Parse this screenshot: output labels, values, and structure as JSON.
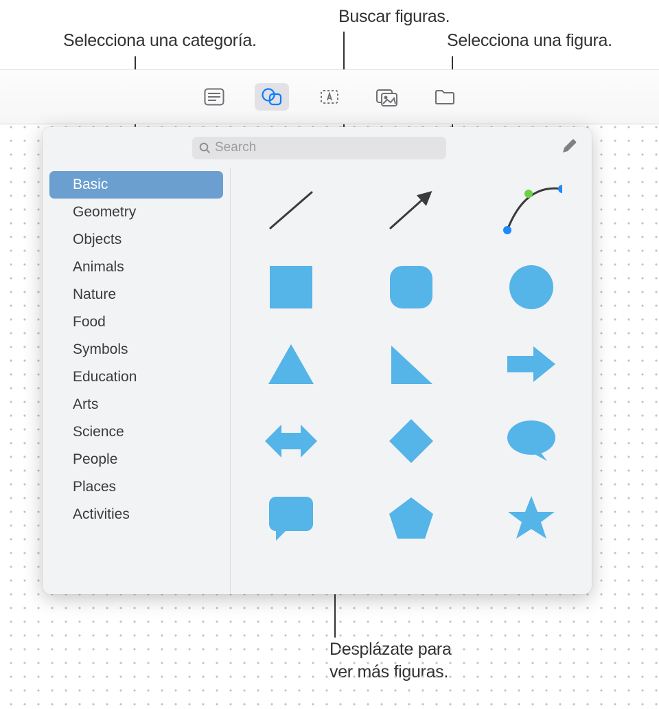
{
  "callouts": {
    "search": "Buscar figuras.",
    "category": "Selecciona una categoría.",
    "shape": "Selecciona una figura.",
    "scroll_line1": "Desplázate para",
    "scroll_line2": "ver más figuras."
  },
  "toolbar": {
    "buttons": [
      {
        "name": "text-tool-icon"
      },
      {
        "name": "shapes-tool-icon"
      },
      {
        "name": "textbox-tool-icon"
      },
      {
        "name": "media-tool-icon"
      },
      {
        "name": "folder-tool-icon"
      }
    ],
    "active_index": 1
  },
  "search": {
    "placeholder": "Search",
    "value": ""
  },
  "categories": [
    "Basic",
    "Geometry",
    "Objects",
    "Animals",
    "Nature",
    "Food",
    "Symbols",
    "Education",
    "Arts",
    "Science",
    "People",
    "Places",
    "Activities"
  ],
  "selected_category_index": 0,
  "shape_color": "#55b4e8",
  "shapes": [
    "line",
    "arrow-line",
    "curve",
    "square",
    "rounded-square",
    "circle",
    "triangle",
    "right-triangle",
    "right-arrow",
    "double-arrow",
    "diamond",
    "speech-bubble-oval",
    "speech-bubble-rect",
    "pentagon",
    "star"
  ]
}
